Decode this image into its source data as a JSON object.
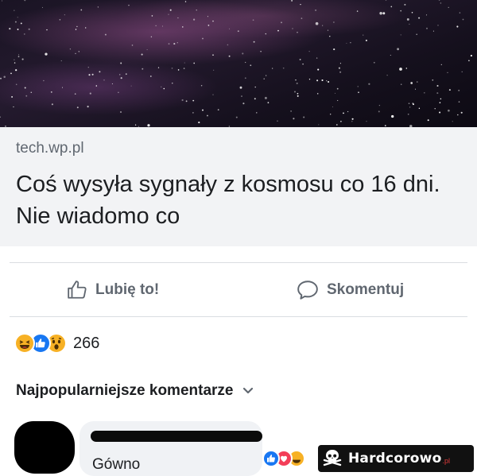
{
  "link_preview": {
    "image_icon": "galaxy-night-sky-image",
    "domain": "tech.wp.pl",
    "headline": "Coś wysyła sygnały z kosmosu co 16 dni. Nie wiadomo co"
  },
  "actions": {
    "like_label": "Lubię to!",
    "like_icon": "thumbs-up-icon",
    "comment_label": "Skomentuj",
    "comment_icon": "comment-bubble-icon"
  },
  "reactions": {
    "icons": [
      "haha-reaction-icon",
      "like-reaction-icon",
      "wow-reaction-icon"
    ],
    "count": "266"
  },
  "comments": {
    "header": "Najpopularniejsze komentarze",
    "header_icon": "chevron-down-icon",
    "items": [
      {
        "author_redacted": true,
        "text": "Gówno",
        "reaction_icons": [
          "like-reaction-icon",
          "love-reaction-icon",
          "haha-reaction-icon"
        ]
      }
    ]
  },
  "watermark": {
    "brand": "Hardcorowo",
    "suffix": ".pl",
    "icon": "skull-crossbones-icon"
  },
  "colors": {
    "link_card_bg": "#f2f3f5",
    "muted_text": "#606770",
    "like_blue": "#1877f2",
    "haha_yellow": "#f7b125",
    "love_red": "#f33e58"
  }
}
